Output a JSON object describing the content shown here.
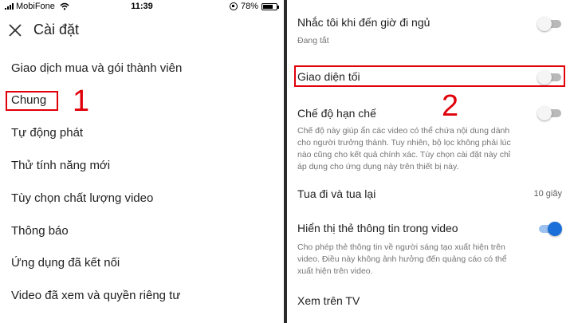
{
  "status_bar": {
    "carrier": "MobiFone",
    "time": "11:39",
    "battery": "78%",
    "battery_level": 0.78
  },
  "left_panel": {
    "title": "Cài đặt",
    "items": [
      {
        "label": "Giao dịch mua và gói thành viên"
      },
      {
        "label": "Chung"
      },
      {
        "label": "Tự động phát"
      },
      {
        "label": "Thử tính năng mới"
      },
      {
        "label": "Tùy chọn chất lượng video"
      },
      {
        "label": "Thông báo"
      },
      {
        "label": "Ứng dụng đã kết nối"
      },
      {
        "label": "Video đã xem và quyền riêng tư"
      }
    ],
    "step_number": "1"
  },
  "right_panel": {
    "bedtime": {
      "title": "Nhắc tôi khi đến giờ đi ngủ",
      "status": "Đang tắt",
      "on": false
    },
    "dark_theme": {
      "title": "Giao diện tối",
      "on": false
    },
    "restricted": {
      "title": "Chế độ hạn chế",
      "desc_lines": [
        "Chế độ này giúp ẩn các video có thể chứa nội dung dành",
        "cho người trưởng thành. Tuy nhiên, bộ lọc không phải lúc",
        "nào cũng cho kết quả chính xác. Tùy chọn cài đặt này chỉ",
        "áp dụng cho ứng dụng này trên thiết bị này."
      ],
      "on": false
    },
    "seek": {
      "title": "Tua đi và tua lại",
      "value": "10 giây"
    },
    "cards": {
      "title": "Hiển thị thẻ thông tin trong video",
      "desc_lines": [
        "Cho phép thẻ thông tin về người sáng tạo xuất hiện trên",
        "video. Điều này không ảnh hưởng đến quảng cáo có thể",
        "xuất hiện trên video."
      ],
      "on": true
    },
    "watch_on_tv": {
      "title": "Xem trên TV"
    },
    "step_number": "2"
  },
  "colors": {
    "highlight": "#e0000a",
    "toggle_on": "#1a6fd8",
    "toggle_off_track": "#b9b9b9"
  }
}
